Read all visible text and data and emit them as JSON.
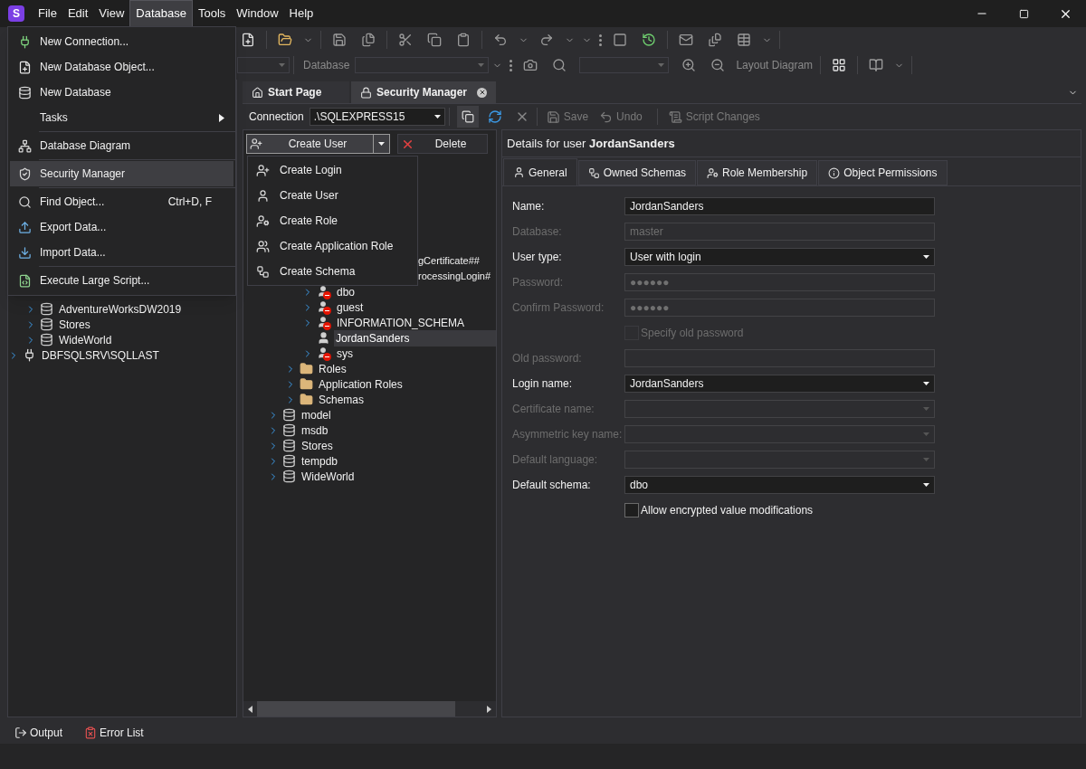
{
  "logo_letter": "S",
  "menu_bar": [
    {
      "label": "File",
      "selected": false
    },
    {
      "label": "Edit",
      "selected": false
    },
    {
      "label": "View",
      "selected": false
    },
    {
      "label": "Database",
      "selected": true
    },
    {
      "label": "Tools",
      "selected": false
    },
    {
      "label": "Window",
      "selected": false
    },
    {
      "label": "Help",
      "selected": false
    }
  ],
  "toolbar": {
    "database_label": "Database",
    "layout_button": "Layout Diagram"
  },
  "database_menu": [
    {
      "kind": "item",
      "label": "New Connection...",
      "selected": false
    },
    {
      "kind": "item",
      "label": "New Database Object...",
      "selected": false
    },
    {
      "kind": "item",
      "label": "New Database",
      "selected": false
    },
    {
      "kind": "submenu",
      "label": "Tasks",
      "selected": false
    },
    {
      "kind": "separator"
    },
    {
      "kind": "item",
      "label": "Database Diagram",
      "selected": false
    },
    {
      "kind": "separator"
    },
    {
      "kind": "item",
      "label": "Security Manager",
      "selected": true
    },
    {
      "kind": "separator"
    },
    {
      "kind": "item",
      "label": "Find Object...",
      "shortcut": "Ctrl+D, F",
      "selected": false
    },
    {
      "kind": "item",
      "label": "Export Data...",
      "selected": false
    },
    {
      "kind": "item",
      "label": "Import Data...",
      "selected": false
    },
    {
      "kind": "separator"
    },
    {
      "kind": "item",
      "label": "Execute Large Script...",
      "selected": false
    }
  ],
  "document_tabs": [
    {
      "label": "Start Page",
      "selected": false,
      "closable": false
    },
    {
      "label": "Security Manager",
      "selected": true,
      "closable": true
    }
  ],
  "connection_bar": {
    "label": "Connection",
    "value": ".\\SQLEXPRESS15",
    "actions": [
      {
        "kind": "save",
        "label": "Save",
        "disabled": true
      },
      {
        "kind": "undo",
        "label": "Undo",
        "disabled": true
      },
      {
        "kind": "script",
        "label": "Script Changes",
        "disabled": true
      }
    ]
  },
  "object_toolbar": {
    "create_button": "Create User",
    "delete_button": "Delete"
  },
  "create_menu": [
    {
      "kind": "login",
      "label": "Create Login"
    },
    {
      "kind": "user",
      "label": "Create User"
    },
    {
      "kind": "role",
      "label": "Create Role"
    },
    {
      "kind": "app_role",
      "label": "Create Application Role"
    },
    {
      "kind": "schema",
      "label": "Create Schema"
    }
  ],
  "explorer_tree": [
    {
      "kind": "hidden",
      "children": [
        {
          "kind": "database",
          "label": "AdventureWorksDW2019",
          "expandable": true
        },
        {
          "kind": "database",
          "label": "Stores",
          "expandable": true
        },
        {
          "kind": "database",
          "label": "WideWorld",
          "expandable": true
        }
      ]
    },
    {
      "kind": "server",
      "label": "DBFSQLSRV\\SQLLAST",
      "expandable": true
    }
  ],
  "object_tree": [
    {
      "kind": "hidden",
      "children": [
        {
          "kind": "hidden",
          "children": [
            {
              "kind": "hidden",
              "children": [
                {
                  "kind": "clipped",
                  "label": "gCertificate##",
                  "selected": false
                },
                {
                  "kind": "clipped",
                  "label": "rocessingLogin#",
                  "selected": false
                },
                {
                  "kind": "user_denied",
                  "label": "dbo",
                  "expandable": true,
                  "selected": false
                },
                {
                  "kind": "user_denied",
                  "label": "guest",
                  "expandable": true,
                  "selected": false
                },
                {
                  "kind": "user_denied",
                  "label": "INFORMATION_SCHEMA",
                  "expandable": true,
                  "selected": false
                },
                {
                  "kind": "user",
                  "label": "JordanSanders",
                  "expandable": false,
                  "selected": true
                },
                {
                  "kind": "user_denied",
                  "label": "sys",
                  "expandable": true,
                  "selected": false
                }
              ]
            },
            {
              "kind": "folder",
              "label": "Roles",
              "expandable": true,
              "selected": false
            },
            {
              "kind": "folder",
              "label": "Application Roles",
              "expandable": true,
              "selected": false
            },
            {
              "kind": "folder",
              "label": "Schemas",
              "expandable": true,
              "selected": false
            }
          ]
        },
        {
          "kind": "database",
          "label": "model",
          "expandable": true,
          "selected": false
        },
        {
          "kind": "database",
          "label": "msdb",
          "expandable": true,
          "selected": false
        },
        {
          "kind": "database",
          "label": "Stores",
          "expandable": true,
          "selected": false
        },
        {
          "kind": "database",
          "label": "tempdb",
          "expandable": true,
          "selected": false
        },
        {
          "kind": "database",
          "label": "WideWorld",
          "expandable": true,
          "selected": false
        }
      ]
    }
  ],
  "details": {
    "title": "Details for user **JordanSanders**"
  },
  "detail_tabs": [
    {
      "kind": "general",
      "label": "General",
      "selected": true
    },
    {
      "kind": "schemas",
      "label": "Owned Schemas",
      "selected": false
    },
    {
      "kind": "roles",
      "label": "Role Membership",
      "selected": false
    },
    {
      "kind": "permissions",
      "label": "Object Permissions",
      "selected": false
    }
  ],
  "fields": [
    {
      "kind": "text",
      "label": "Name:",
      "value": "JordanSanders",
      "disabled": false
    },
    {
      "kind": "text",
      "label": "Database:",
      "value": "master",
      "disabled": true
    },
    {
      "kind": "combo",
      "label": "User type:",
      "value": "User with login",
      "disabled": false
    },
    {
      "kind": "text",
      "label": "Password:",
      "value": "●●●●●●",
      "disabled": true
    },
    {
      "kind": "text",
      "label": "Confirm Password:",
      "value": "●●●●●●",
      "disabled": true
    },
    {
      "kind": "checkbox",
      "label": "Specify old password",
      "checked": false,
      "disabled": true
    },
    {
      "kind": "text",
      "label": "Old password:",
      "disabled": true
    },
    {
      "kind": "combo",
      "label": "Login name:",
      "value": "JordanSanders",
      "disabled": false
    },
    {
      "kind": "combo",
      "label": "Certificate name:",
      "disabled": true
    },
    {
      "kind": "combo",
      "label": "Asymmetric key name:",
      "disabled": true
    },
    {
      "kind": "combo",
      "label": "Default language:",
      "disabled": true
    },
    {
      "kind": "combo",
      "label": "Default schema:",
      "value": "dbo",
      "disabled": false
    },
    {
      "kind": "checkbox",
      "label": "Allow encrypted value modifications",
      "checked": false,
      "disabled": false
    }
  ],
  "status_bar": [
    {
      "kind": "output",
      "label": "Output"
    },
    {
      "kind": "errors",
      "label": "Error List"
    }
  ]
}
